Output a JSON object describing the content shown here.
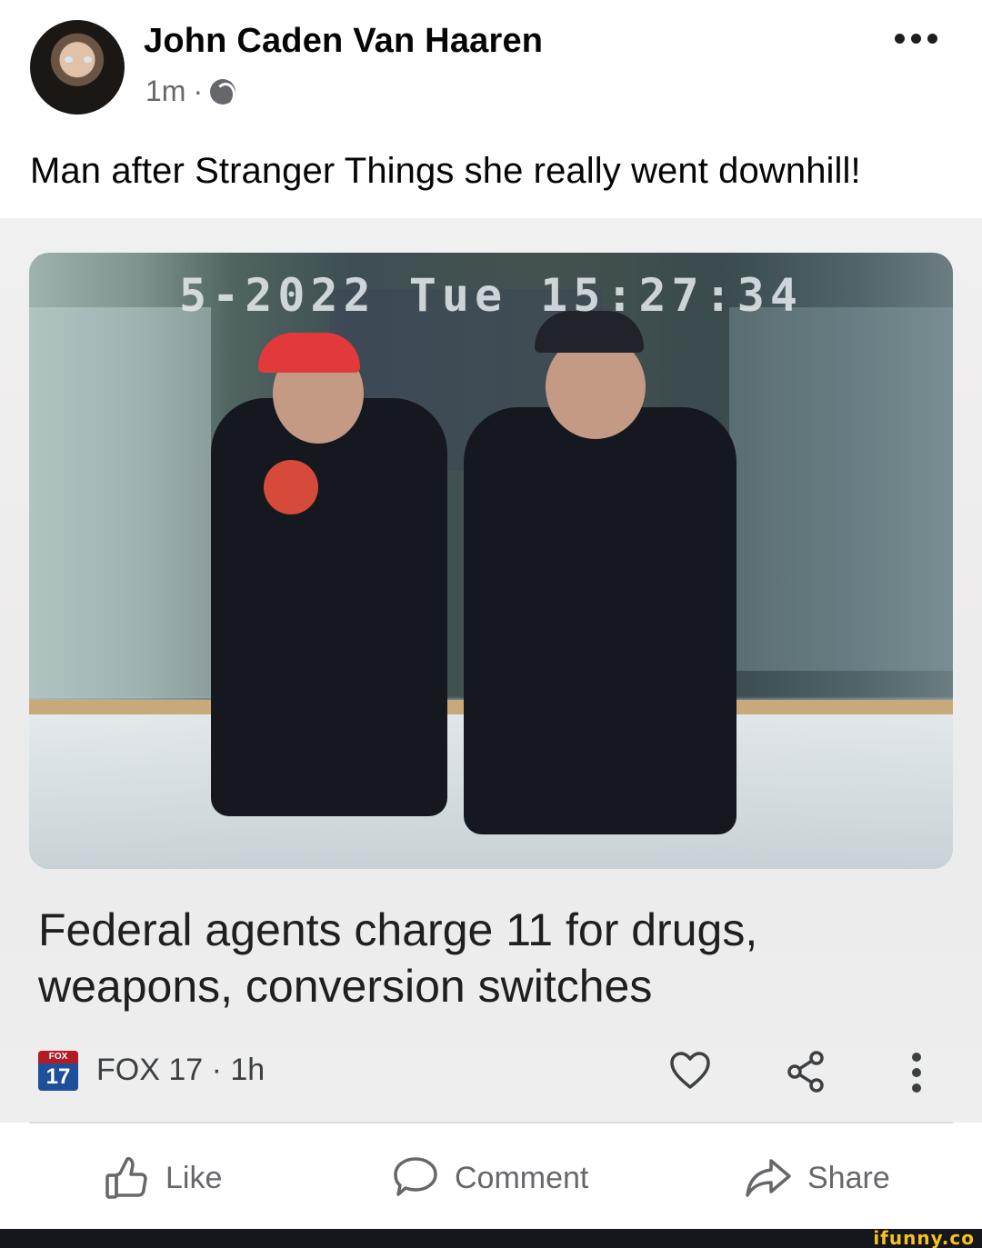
{
  "post": {
    "author": "John Caden Van Haaren",
    "time": "1m",
    "separator": "·",
    "text": "Man after Stranger Things she really went downhill!"
  },
  "card": {
    "timestamp": "5-2022 Tue 15:27:34",
    "headline": "Federal agents charge 11 for drugs, weapons, conversion switches",
    "source_logo_top": "FOX",
    "source_logo_num": "17",
    "source": "FOX 17 · 1h"
  },
  "actions": {
    "like": "Like",
    "comment": "Comment",
    "share": "Share"
  },
  "watermark": "ifunny.co",
  "icons": {
    "globe": "globe-icon",
    "more": "more-horizontal-icon",
    "heart": "heart-icon",
    "share_nodes": "share-nodes-icon",
    "kebab": "more-vertical-icon",
    "like": "thumbs-up-icon",
    "comment": "comment-bubble-icon",
    "share": "share-arrow-icon"
  }
}
